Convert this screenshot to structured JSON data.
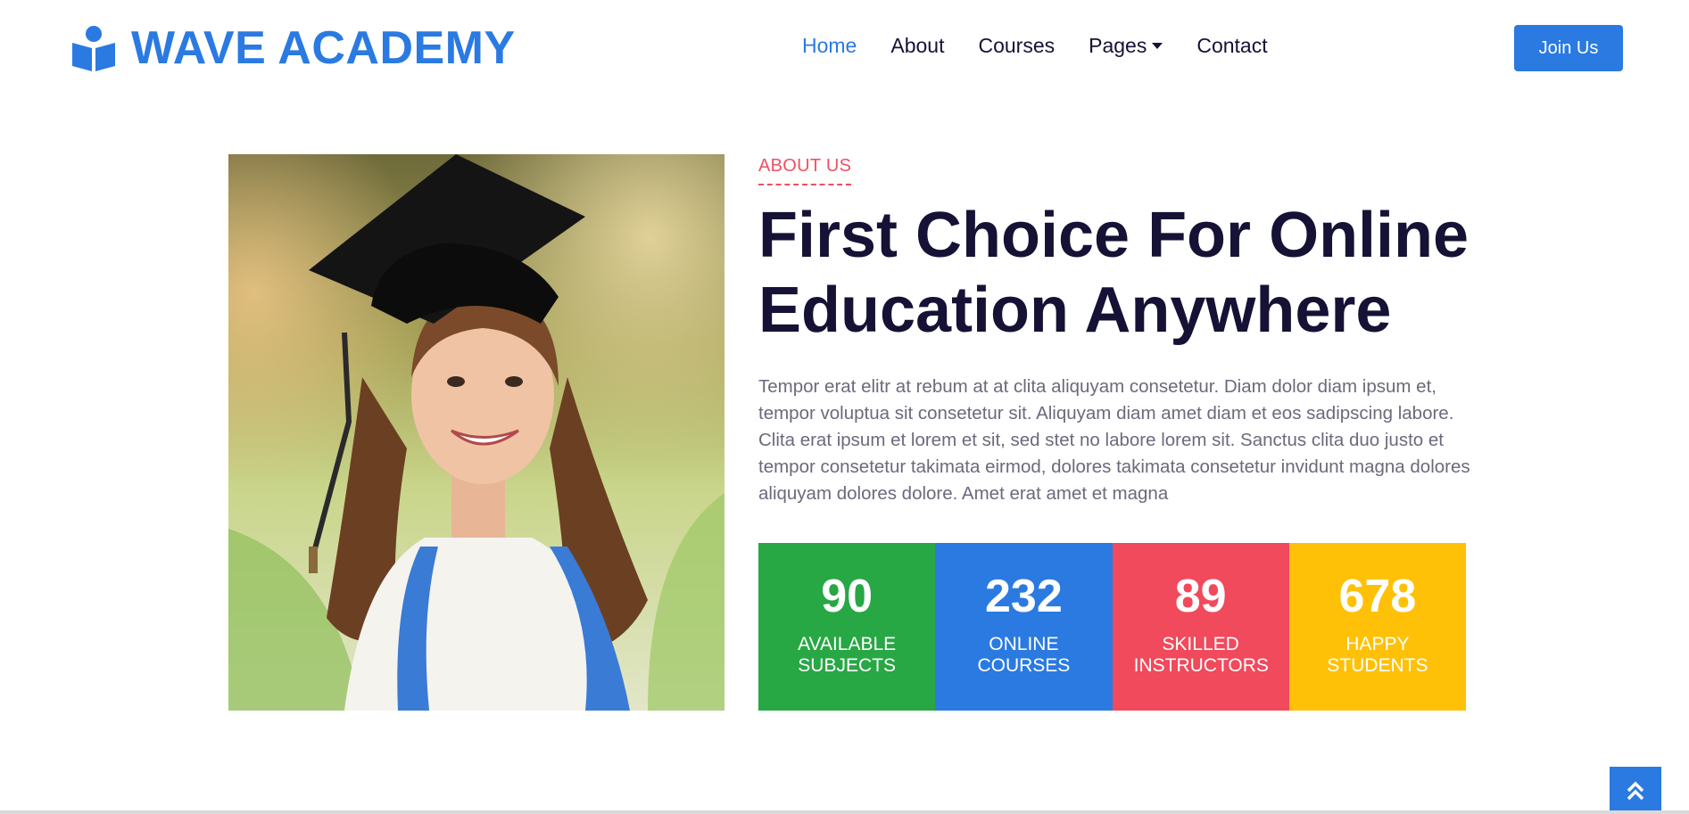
{
  "brand": {
    "name": "WAVE ACADEMY",
    "icon": "book-reader-icon",
    "color": "#2a7ae2"
  },
  "nav": {
    "items": [
      {
        "label": "Home",
        "active": true
      },
      {
        "label": "About",
        "active": false
      },
      {
        "label": "Courses",
        "active": false
      },
      {
        "label": "Pages",
        "active": false,
        "dropdown": true
      },
      {
        "label": "Contact",
        "active": false
      }
    ],
    "cta": "Join Us"
  },
  "about": {
    "eyebrow": "ABOUT US",
    "headline_line1": "First Choice For Online",
    "headline_line2": "Education Anywhere",
    "description": "Tempor erat elitr at rebum at at clita aliquyam consetetur. Diam dolor diam ipsum et, tempor voluptua sit consetetur sit. Aliquyam diam amet diam et eos sadipscing labore. Clita erat ipsum et lorem et sit, sed stet no labore lorem sit. Sanctus clita duo justo et tempor consetetur takimata eirmod, dolores takimata consetetur invidunt magna dolores aliquyam dolores dolore. Amet erat amet et magna",
    "image": "graduate-student-photo"
  },
  "stats": [
    {
      "value": "90",
      "label": "Available Subjects",
      "color": "#28a745"
    },
    {
      "value": "232",
      "label": "Online Courses",
      "color": "#2a7ae2"
    },
    {
      "value": "89",
      "label": "Skilled Instructors",
      "color": "#f04a5c"
    },
    {
      "value": "678",
      "label": "Happy Students",
      "color": "#ffc107"
    }
  ],
  "back_to_top": {
    "icon": "double-chevron-up-icon"
  },
  "colors": {
    "primary": "#2a7ae2",
    "accent": "#f05060",
    "dark": "#151235"
  }
}
